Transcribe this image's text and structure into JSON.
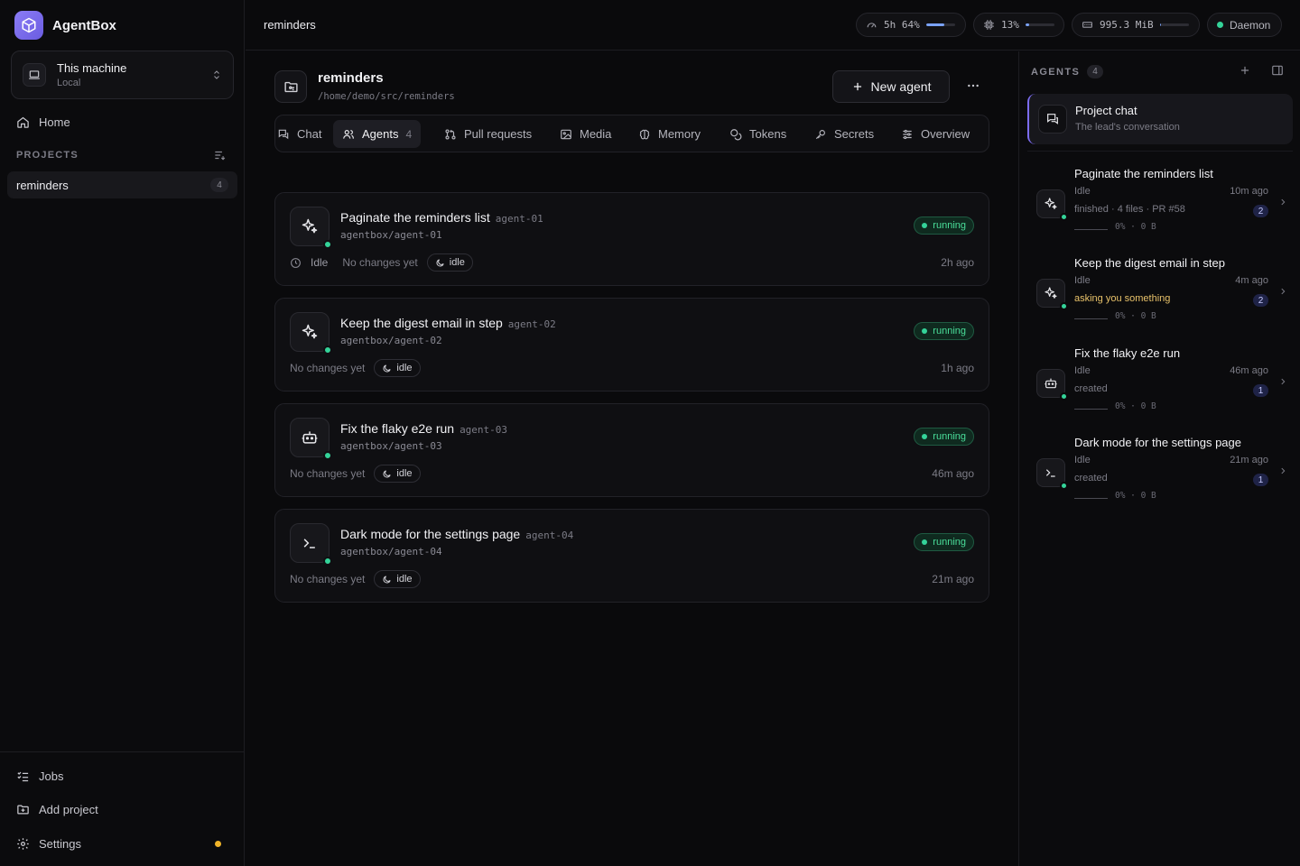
{
  "brand": {
    "name": "AgentBox"
  },
  "machine": {
    "title": "This machine",
    "subtitle": "Local"
  },
  "nav": {
    "home": "Home",
    "projects_header": "PROJECTS",
    "jobs": "Jobs",
    "add_project": "Add project",
    "settings": "Settings"
  },
  "projects": [
    {
      "name": "reminders",
      "count": "4"
    }
  ],
  "topbar": {
    "title": "reminders",
    "usage": {
      "label": "5h 64%",
      "level": 0.64,
      "color": "#7aa2f7"
    },
    "cpu": {
      "label": "13%",
      "level": 0.13,
      "color": "#7aa2f7"
    },
    "memory": {
      "label": "995.3 MiB",
      "level": 0.04,
      "color": "#7aa2f7"
    },
    "daemon": "Daemon"
  },
  "repo": {
    "name": "reminders",
    "path": "/home/demo/src/reminders",
    "new_agent": "New agent"
  },
  "tabs": [
    {
      "label": "Chat",
      "icon": "chat-icon"
    },
    {
      "label": "Agents",
      "count": "4",
      "icon": "users-icon",
      "active": true
    },
    {
      "label": "Pull requests",
      "icon": "git-pull-request-icon"
    },
    {
      "label": "Media",
      "icon": "image-icon"
    },
    {
      "label": "Memory",
      "icon": "brain-icon"
    },
    {
      "label": "Tokens",
      "icon": "coins-icon"
    },
    {
      "label": "Secrets",
      "icon": "key-icon"
    },
    {
      "label": "Overview",
      "icon": "sliders-icon"
    }
  ],
  "agents": [
    {
      "title": "Paginate the reminders list",
      "id": "agent-01",
      "branch": "agentbox/agent-01",
      "status": "running",
      "idle_label": "Idle",
      "changes": "No changes yet",
      "state": "idle",
      "time": "2h ago",
      "icon": "sparkles-icon"
    },
    {
      "title": "Keep the digest email in step",
      "id": "agent-02",
      "branch": "agentbox/agent-02",
      "status": "running",
      "changes": "No changes yet",
      "state": "idle",
      "time": "1h ago",
      "icon": "sparkles-icon"
    },
    {
      "title": "Fix the flaky e2e run",
      "id": "agent-03",
      "branch": "agentbox/agent-03",
      "status": "running",
      "changes": "No changes yet",
      "state": "idle",
      "time": "46m ago",
      "icon": "bot-icon"
    },
    {
      "title": "Dark mode for the settings page",
      "id": "agent-04",
      "branch": "agentbox/agent-04",
      "status": "running",
      "changes": "No changes yet",
      "state": "idle",
      "time": "21m ago",
      "icon": "terminal-icon"
    }
  ],
  "panel": {
    "header": "AGENTS",
    "count": "4",
    "project_chat": {
      "title": "Project chat",
      "subtitle": "The lead's conversation"
    },
    "agents": [
      {
        "title": "Paginate the reminders list",
        "status": "Idle",
        "time": "10m ago",
        "detail": "finished · 4 files · PR #58",
        "detail_warn": false,
        "num": "2",
        "progress": "0% · 0 B"
      },
      {
        "title": "Keep the digest email in step",
        "status": "Idle",
        "time": "4m ago",
        "detail": "asking you something",
        "detail_warn": true,
        "num": "2",
        "progress": "0% · 0 B"
      },
      {
        "title": "Fix the flaky e2e run",
        "status": "Idle",
        "time": "46m ago",
        "detail": "created",
        "detail_warn": false,
        "num": "1",
        "progress": "0% · 0 B"
      },
      {
        "title": "Dark mode for the settings page",
        "status": "Idle",
        "time": "21m ago",
        "detail": "created",
        "detail_warn": false,
        "num": "1",
        "progress": "0% · 0 B"
      }
    ]
  },
  "colors": {
    "accent": "#7c6cf0",
    "running": "#34d399",
    "warning": "#e8c26a"
  }
}
